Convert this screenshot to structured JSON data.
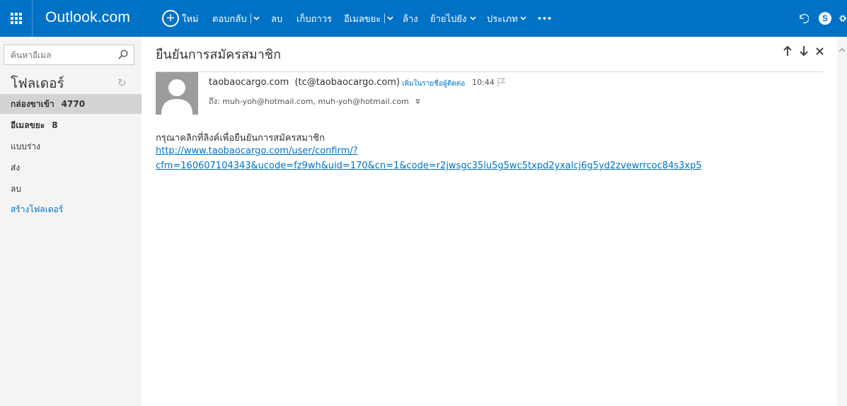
{
  "header": {
    "app_title": "Outlook.com",
    "commands": {
      "new_label": "ใหม่",
      "reply_label": "ตอบกลับ",
      "delete_label": "ลบ",
      "archive_label": "เก็บถาวร",
      "junk_label": "อีเมลขยะ",
      "sweep_label": "ล้าง",
      "move_label": "ย้ายไปยัง",
      "categories_label": "ประเภท",
      "more_label": "•••"
    },
    "icons": [
      "waffle-icon",
      "plus-circle-icon",
      "chevron-down-icon",
      "undo-icon",
      "skype-icon",
      "gear-icon"
    ],
    "accent_color": "#0072c6"
  },
  "sidebar": {
    "search_placeholder": "ค้นหาอีเมล",
    "folders_heading": "โฟลเดอร์",
    "folders": [
      {
        "label": "กล่องขาเข้า",
        "count": "4770"
      },
      {
        "label": "อีเมลขยะ",
        "count": "8"
      },
      {
        "label": "แบบร่าง",
        "count": ""
      },
      {
        "label": "ส่ง",
        "count": ""
      },
      {
        "label": "ลบ",
        "count": ""
      }
    ],
    "create_folder_label": "สร้างโฟลเดอร์"
  },
  "message": {
    "subject": "ยืนยันการสมัครสมาชิก",
    "sender_name": "taobaocargo.com",
    "sender_email": "(tc@taobaocargo.com)",
    "add_contact_label": "เพิ่มในรายชื่อผู้ติดต่อ",
    "time": "10:44",
    "to_label": "ถึง:",
    "recipients": "muh-yoh@hotmail.com, muh-yoh@hotmail.com",
    "body_text": "กรุณาคลิกที่ลิงค์เพื่อยืนยันการสมัครสมาชิก",
    "link_line1": "http://www.taobaocargo.com/user/confirm/?",
    "link_line2": "cfm=160607104343&ucode=fz9wh&uid=170&cn=1&code=r2jwsgc35lu5g5wc5txpd2yxalcj6g5yd2zvewrrcoc84s3xp5"
  }
}
